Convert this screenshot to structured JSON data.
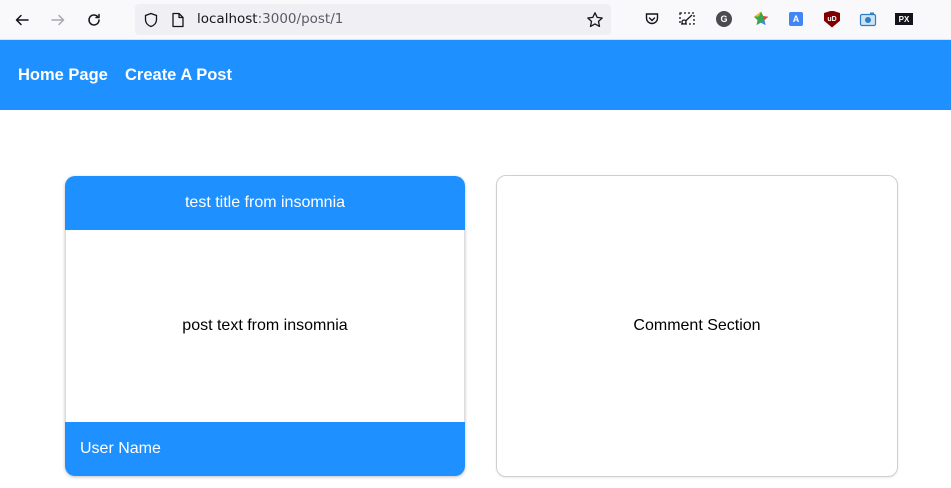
{
  "browser": {
    "url_host": "localhost",
    "url_rest": ":3000/post/1"
  },
  "nav": {
    "home_label": "Home Page",
    "create_label": "Create A Post"
  },
  "post": {
    "title": "test title from insomnia",
    "text": "post text from insomnia",
    "username": "User Name"
  },
  "comments": {
    "label": "Comment Section"
  },
  "colors": {
    "accent": "#1e90ff"
  },
  "extensions": {
    "g_label": "G",
    "ub_label": "uD",
    "px_label": "PX",
    "translate_label": "A"
  }
}
